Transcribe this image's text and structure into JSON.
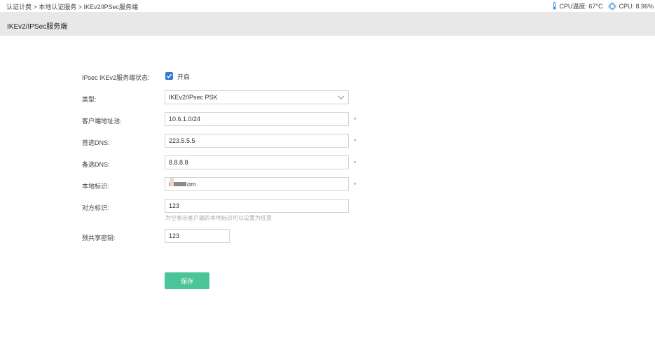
{
  "breadcrumb": "认证计费 > 本地认证服务 > IKEv2/IPSec服务端",
  "status": {
    "cpu_temp": "CPU温度: 67°C",
    "cpu_usage": "CPU: 8.96%"
  },
  "page_title": "IKEv2/IPSec服务端",
  "form": {
    "status_label": "IPsec IKEv2服务端状态:",
    "status_checked": true,
    "status_check_text": "开启",
    "type_label": "类型:",
    "type_value": "IKEv2/IPsec PSK",
    "pool_label": "客户端地址池:",
    "pool_value": "10.6.1.0/24",
    "dns1_label": "首选DNS:",
    "dns1_value": "223.5.5.5",
    "dns2_label": "备选DNS:",
    "dns2_value": "8.8.8.8",
    "local_id_label": "本地标识:",
    "local_id_prefix": "i",
    "local_id_suffix": "om",
    "remote_id_label": "对方标识:",
    "remote_id_value": "123",
    "remote_id_hint": "为空表示客户端的本地标识可以设置为任意",
    "psk_label": "预共享密钥:",
    "psk_value": "123",
    "required_mark": "*",
    "save_label": "保存"
  },
  "colors": {
    "accent": "#2f7ad8",
    "save": "#4cc49a",
    "required": "#e05a5a",
    "titlebar": "#e8e8e8"
  },
  "icons": [
    "thermometer-icon",
    "cpu-icon",
    "chevron-down-icon",
    "checkmark-icon"
  ]
}
